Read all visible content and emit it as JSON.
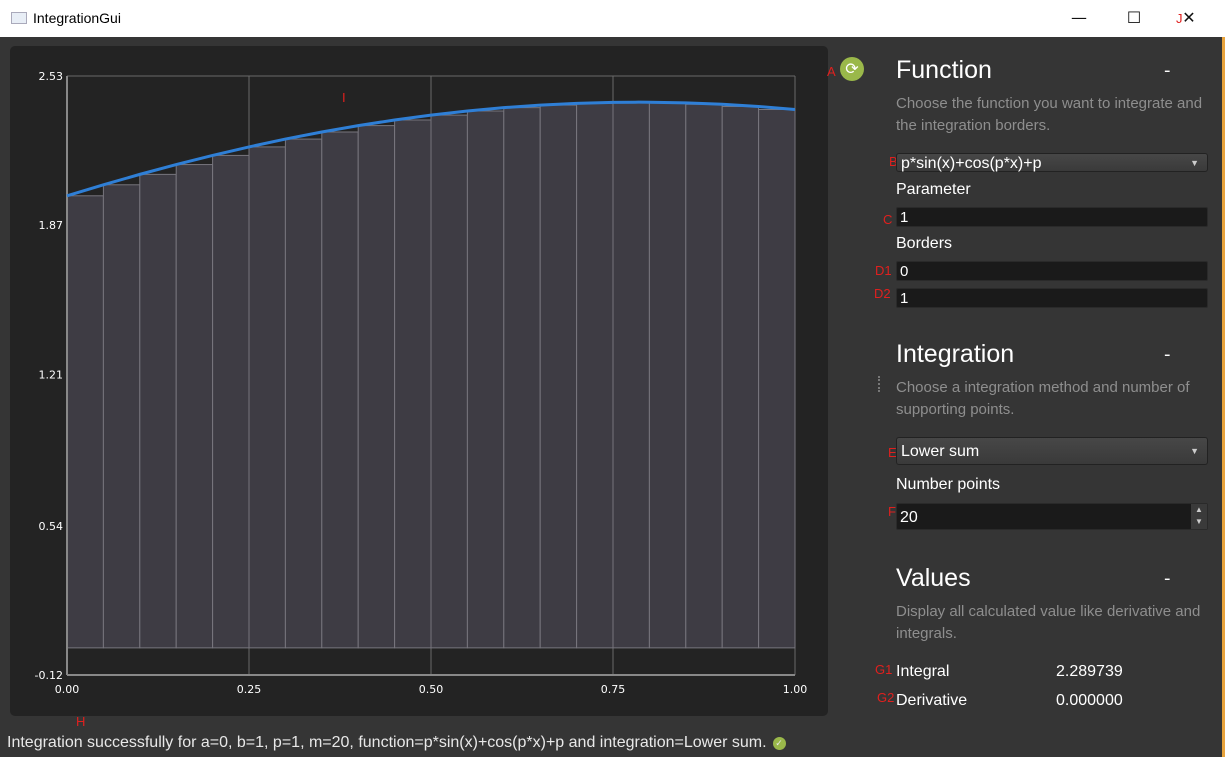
{
  "window": {
    "title": "IntegrationGui",
    "app_icon": "chart-line-icon",
    "controls": {
      "minimize": "—",
      "maximize": "☐",
      "close": "✕"
    }
  },
  "annotations": {
    "A": "A",
    "B": "B",
    "C": "C",
    "D1": "D1",
    "D2": "D2",
    "E": "E",
    "F": "F",
    "G1": "G1",
    "G2": "G2",
    "H": "H",
    "I": "I",
    "J": "J"
  },
  "function_section": {
    "title": "Function",
    "collapse": "-",
    "description": "Choose the function you want to integrate and the integration borders.",
    "function_value": "p*sin(x)+cos(p*x)+p",
    "parameter_label": "Parameter",
    "parameter_value": "1",
    "borders_label": "Borders",
    "border_a": "0",
    "border_b": "1"
  },
  "integration_section": {
    "title": "Integration",
    "collapse": "-",
    "description": "Choose a integration method and number of supporting points.",
    "method_value": "Lower sum",
    "points_label": "Number points",
    "points_value": "20"
  },
  "values_section": {
    "title": "Values",
    "collapse": "-",
    "description": "Display all calculated value like derivative and integrals.",
    "integral_label": "Integral",
    "integral_value": "2.289739",
    "derivative_label": "Derivative",
    "derivative_value": "0.000000"
  },
  "status": {
    "text": "Integration successfully for a=0, b=1, p=1, m=20, function=p*sin(x)+cos(p*x)+p and integration=Lower sum.",
    "icon": "check-icon"
  },
  "colors": {
    "curve": "#2f7fd6",
    "bars": "#3e3c44",
    "bar_edge": "#77757d",
    "plot_bg": "#232323",
    "accent_ok": "#9ab84a"
  },
  "chart_data": {
    "type": "bar",
    "xlim": [
      0,
      1
    ],
    "ylim": [
      -0.12,
      2.53
    ],
    "xticks": [
      "0.00",
      "0.25",
      "0.50",
      "0.75",
      "1.00"
    ],
    "yticks": [
      "2.53",
      "1.87",
      "1.21",
      "0.54",
      "-0.12"
    ],
    "grid": true,
    "bars": {
      "x_left": [
        0,
        0.05,
        0.1,
        0.15,
        0.2,
        0.25,
        0.3,
        0.35,
        0.4,
        0.45,
        0.5,
        0.55,
        0.6,
        0.65,
        0.7,
        0.75,
        0.8,
        0.85,
        0.9,
        0.95
      ],
      "width": 0.05,
      "values": [
        2.0,
        2.0487,
        2.0948,
        2.1382,
        2.1787,
        2.2163,
        2.2509,
        2.2823,
        2.3105,
        2.3354,
        2.357,
        2.3752,
        2.39,
        2.4013,
        2.4091,
        2.4133,
        2.4113,
        2.4049,
        2.3951,
        2.3818
      ]
    },
    "curve": {
      "x": [
        0,
        0.05,
        0.1,
        0.15,
        0.2,
        0.25,
        0.3,
        0.35,
        0.4,
        0.45,
        0.5,
        0.55,
        0.6,
        0.65,
        0.7,
        0.75,
        0.785,
        0.8,
        0.85,
        0.9,
        0.95,
        1.0
      ],
      "y": [
        2.0,
        2.0487,
        2.0948,
        2.1382,
        2.1787,
        2.2163,
        2.2509,
        2.2823,
        2.3105,
        2.3354,
        2.357,
        2.3752,
        2.39,
        2.4013,
        2.4091,
        2.4133,
        2.4142,
        2.4141,
        2.4113,
        2.4049,
        2.3951,
        2.3818
      ]
    }
  }
}
